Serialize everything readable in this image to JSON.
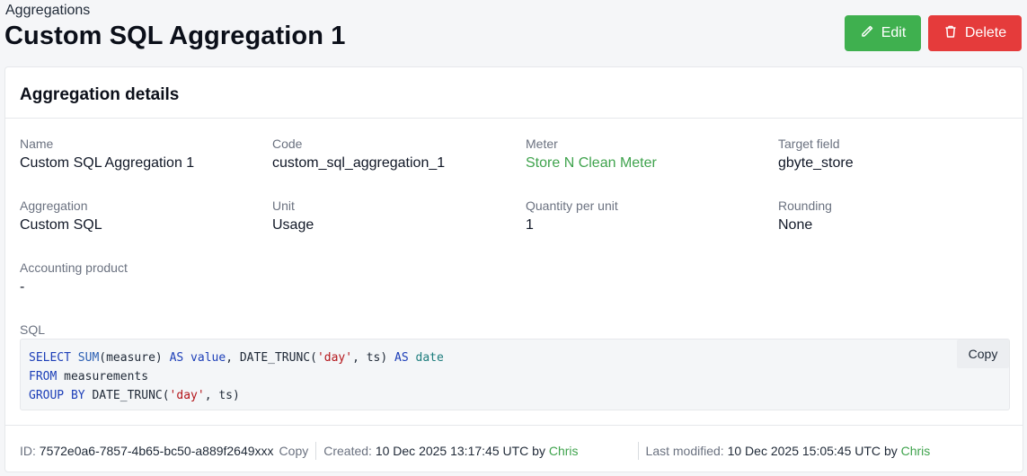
{
  "header": {
    "breadcrumb": "Aggregations",
    "title": "Custom SQL Aggregation 1",
    "edit_label": "Edit",
    "delete_label": "Delete"
  },
  "card": {
    "title": "Aggregation details",
    "fields": {
      "name": {
        "label": "Name",
        "value": "Custom SQL Aggregation 1"
      },
      "code": {
        "label": "Code",
        "value": "custom_sql_aggregation_1"
      },
      "meter": {
        "label": "Meter",
        "value": "Store N Clean Meter"
      },
      "target_field": {
        "label": "Target field",
        "value": "gbyte_store"
      },
      "aggregation": {
        "label": "Aggregation",
        "value": "Custom SQL"
      },
      "unit": {
        "label": "Unit",
        "value": "Usage"
      },
      "quantity_per_unit": {
        "label": "Quantity per unit",
        "value": "1"
      },
      "rounding": {
        "label": "Rounding",
        "value": "None"
      },
      "accounting_product": {
        "label": "Accounting product",
        "value": "-"
      }
    },
    "sql": {
      "label": "SQL",
      "copy_label": "Copy",
      "tokens": {
        "select": "SELECT",
        "sum": "SUM",
        "measure_paren": "(measure)",
        "as1": "AS",
        "value": "value",
        "date_trunc1": "DATE_TRUNC(",
        "day1": "'day'",
        "ts_close1": ", ts)",
        "as2": "AS",
        "date": "date",
        "from": "FROM",
        "measurements": "measurements",
        "group_by": "GROUP BY",
        "date_trunc2": "DATE_TRUNC(",
        "day2": "'day'",
        "ts_close2": ", ts)"
      }
    }
  },
  "footer": {
    "id_label": "ID:",
    "id_value": "7572e0a6-7857-4b65-bc50-a889f2649xxx",
    "id_copy": "Copy",
    "created_label": "Created:",
    "created_value": "10 Dec 2025 13:17:45 UTC",
    "created_by": "by",
    "created_user": "Chris",
    "modified_label": "Last modified:",
    "modified_value": "10 Dec 2025 15:05:45 UTC",
    "modified_by": "by",
    "modified_user": "Chris"
  },
  "colors": {
    "accent_green": "#3fb04f",
    "danger_red": "#e53b3b",
    "link_green": "#3fa34d"
  },
  "icons": [
    "pencil-icon",
    "trash-icon"
  ]
}
